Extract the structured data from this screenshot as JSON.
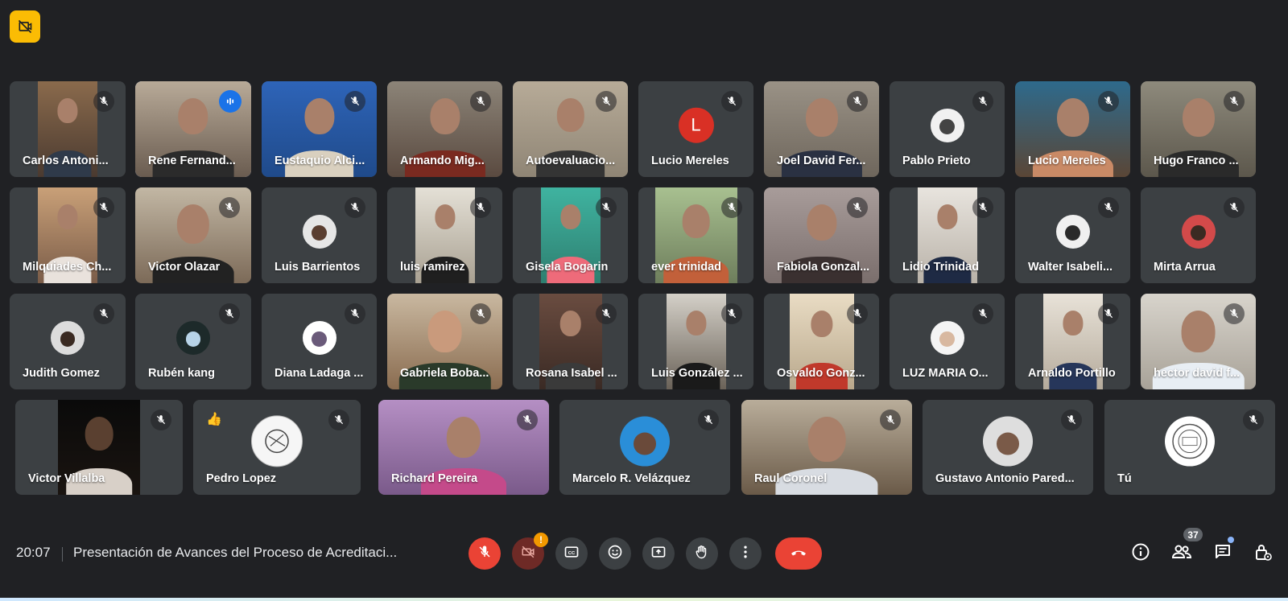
{
  "meeting": {
    "time": "20:07",
    "title": "Presentación de Avances del Proceso de Acreditaci...",
    "participants_count": "37"
  },
  "participants": [
    {
      "name": "Carlos Antoni..."
    },
    {
      "name": "Rene Fernand..."
    },
    {
      "name": "Eustaquio Alci..."
    },
    {
      "name": "Armando Mig..."
    },
    {
      "name": "Autoevaluacio..."
    },
    {
      "name": "Lucio Mereles",
      "initial": "L"
    },
    {
      "name": "Joel David Fer..."
    },
    {
      "name": "Pablo Prieto"
    },
    {
      "name": "Lucio Mereles"
    },
    {
      "name": "Hugo Franco ..."
    },
    {
      "name": "Milquiades Ch..."
    },
    {
      "name": "Victor Olazar"
    },
    {
      "name": "Luis Barrientos"
    },
    {
      "name": "luis ramirez"
    },
    {
      "name": "Gisela Bogarin"
    },
    {
      "name": "ever trinidad"
    },
    {
      "name": "Fabiola Gonzal..."
    },
    {
      "name": "Lidio Trinidad"
    },
    {
      "name": "Walter Isabeli..."
    },
    {
      "name": "Mirta Arrua"
    },
    {
      "name": "Judith Gomez"
    },
    {
      "name": "Rubén kang"
    },
    {
      "name": "Diana Ladaga ..."
    },
    {
      "name": "Gabriela Boba..."
    },
    {
      "name": "Rosana Isabel ..."
    },
    {
      "name": "Luis González ..."
    },
    {
      "name": "Osvaldo Gonz..."
    },
    {
      "name": "LUZ MARIA O..."
    },
    {
      "name": "Arnaldo Portillo"
    },
    {
      "name": "hector david f..."
    },
    {
      "name": "Victor Villalba"
    },
    {
      "name": "Pedro Lopez",
      "reaction": "👍"
    },
    {
      "name": "Richard Pereira"
    },
    {
      "name": "Marcelo R. Velázquez"
    },
    {
      "name": "Raul Coronel"
    },
    {
      "name": "Gustavo Antonio Pared..."
    },
    {
      "name": "Tú"
    }
  ],
  "controls": {
    "icons": [
      "mic-off-icon",
      "camera-off-icon",
      "captions-icon",
      "emoji-icon",
      "present-icon",
      "raise-hand-icon",
      "more-options-icon",
      "end-call-icon"
    ],
    "right_icons": [
      "info-icon",
      "people-icon",
      "chat-icon",
      "host-controls-icon"
    ]
  },
  "colors": {
    "background": "#202124",
    "tile": "#3c4043",
    "accent_blue": "#1a73e8",
    "end_call_red": "#ea4335",
    "recording_yellow": "#fbbc04"
  }
}
